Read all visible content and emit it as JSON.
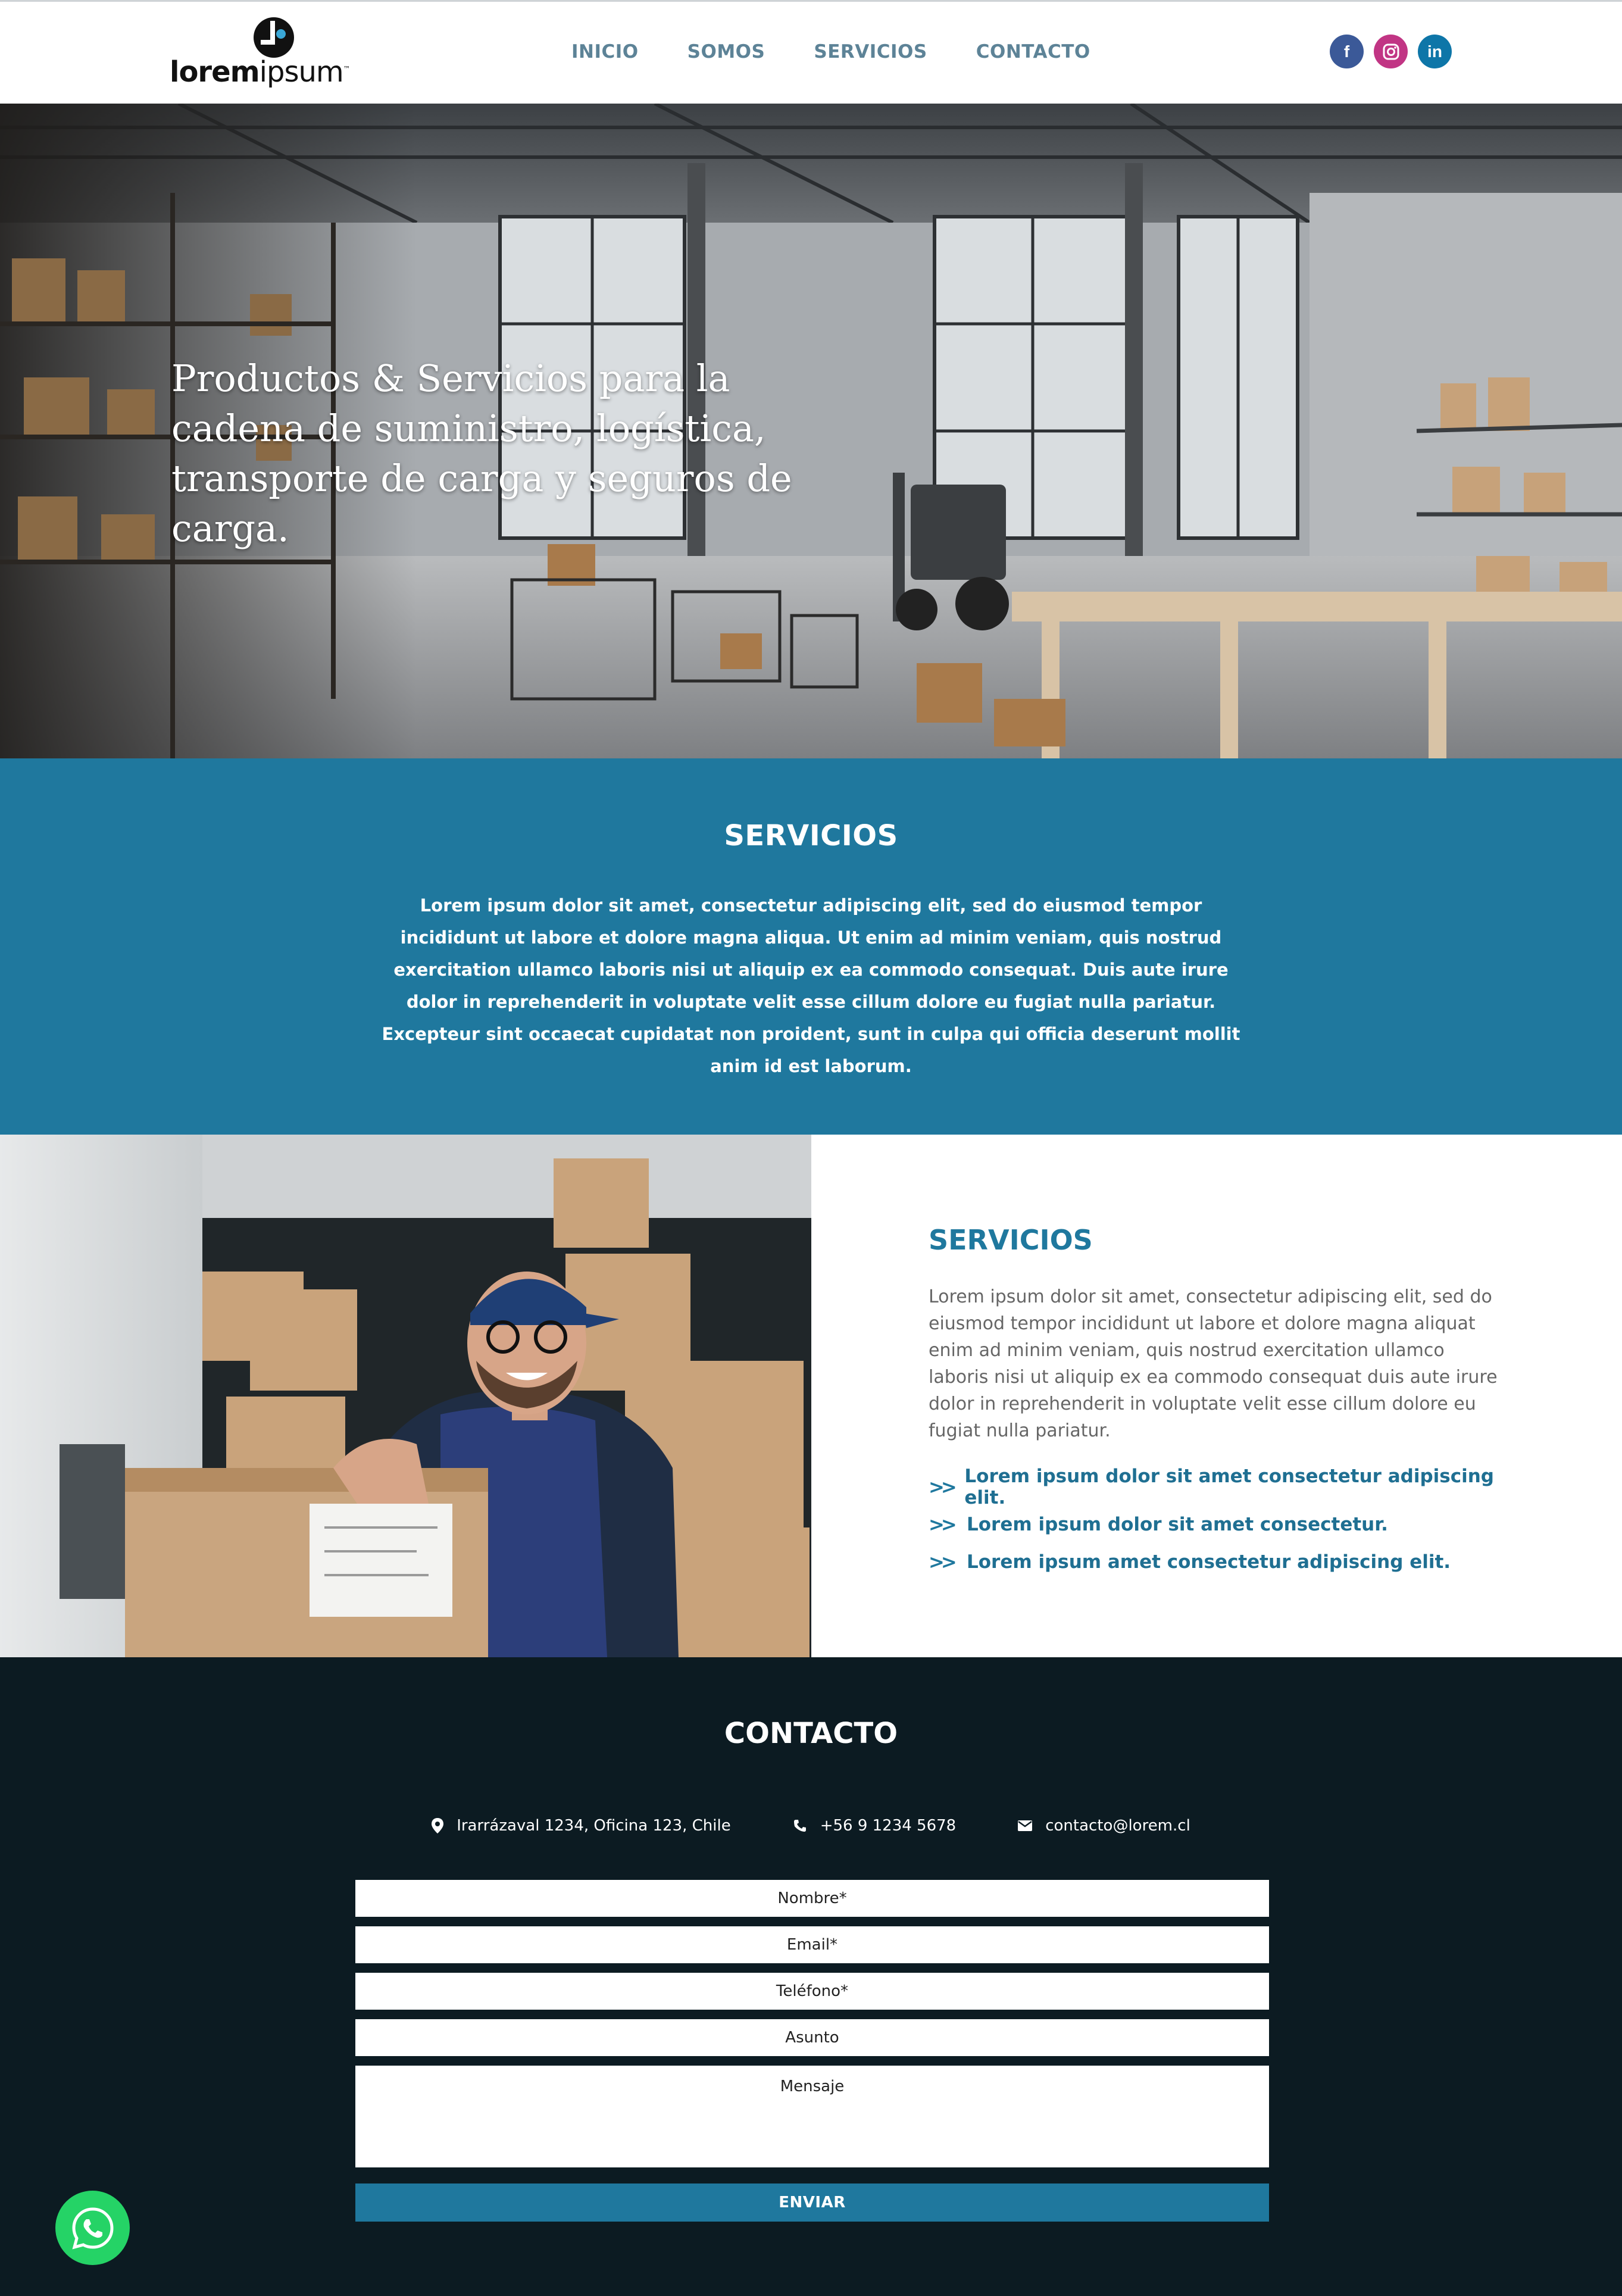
{
  "brand": {
    "logo_bold": "lorem",
    "logo_light": "ipsum",
    "logo_tm": "™"
  },
  "nav": {
    "items": [
      "INICIO",
      "SOMOS",
      "SERVICIOS",
      "CONTACTO"
    ]
  },
  "social": {
    "facebook": "f",
    "linkedin": "in"
  },
  "hero": {
    "title": "Productos & Servicios para la cadena de suministro, logística, transporte de carga y seguros de carga."
  },
  "services_band": {
    "title": "SERVICIOS",
    "text": "Lorem ipsum dolor sit amet, consectetur adipiscing elit, sed do eiusmod tempor incididunt ut labore et dolore magna aliqua. Ut enim ad minim veniam, quis nostrud exercitation ullamco laboris nisi ut aliquip ex ea commodo consequat. Duis aute irure dolor in reprehenderit in voluptate velit esse cillum dolore eu fugiat nulla pariatur. Excepteur sint occaecat cupidatat non proident, sunt in culpa qui officia deserunt mollit anim id est laborum."
  },
  "services_split": {
    "title": "SERVICIOS",
    "text": "Lorem ipsum dolor sit amet, consectetur adipiscing elit, sed do eiusmod tempor incididunt ut labore et dolore magna aliquat enim ad minim veniam, quis nostrud exercitation ullamco laboris nisi ut aliquip ex ea commodo consequat duis aute irure dolor in reprehenderit in voluptate velit esse cillum dolore eu fugiat nulla pariatur.",
    "bullet_marker": ">>",
    "bullets": [
      "Lorem ipsum dolor sit amet consectetur adipiscing elit.",
      "Lorem ipsum dolor sit amet consectetur.",
      "Lorem ipsum amet consectetur adipiscing elit."
    ]
  },
  "contact": {
    "title": "CONTACTO",
    "address": "Irarrázaval 1234, Oficina 123, Chile",
    "phone": "+56 9 1234 5678",
    "email": "contacto@lorem.cl",
    "fields": {
      "name": "Nombre*",
      "email": "Email*",
      "phone": "Teléfono*",
      "subject": "Asunto",
      "message": "Mensaje"
    },
    "submit": "ENVIAR"
  },
  "colors": {
    "primary_blue": "#1f789e",
    "nav_text": "#5d8397",
    "contact_bg": "#0c1b22",
    "whatsapp": "#25d366",
    "facebook": "#3b5998",
    "instagram": "#c13584",
    "linkedin": "#0e76a8"
  },
  "icons": [
    "facebook-icon",
    "instagram-icon",
    "linkedin-icon",
    "location-pin-icon",
    "phone-icon",
    "mail-icon",
    "whatsapp-icon"
  ]
}
